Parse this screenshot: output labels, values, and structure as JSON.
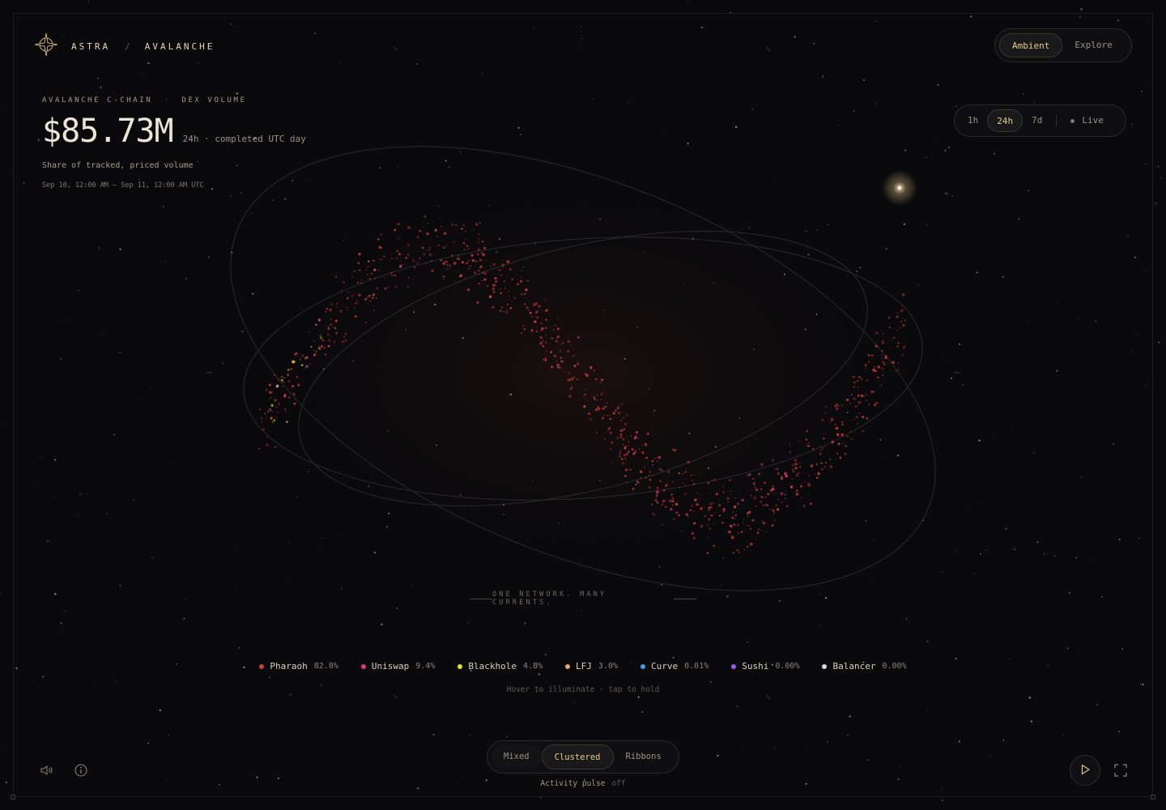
{
  "header": {
    "brand": "ASTRA",
    "separator": "/",
    "network": "AVALANCHE",
    "modes": [
      {
        "label": "Ambient",
        "active": true
      },
      {
        "label": "Explore",
        "active": false
      }
    ]
  },
  "timeframes": [
    {
      "label": "1h",
      "active": false
    },
    {
      "label": "24h",
      "active": true
    },
    {
      "label": "7d",
      "active": false
    }
  ],
  "live_label": "Live",
  "summary": {
    "chain": "AVALANCHE C-CHAIN",
    "metric": "DEX VOLUME",
    "value": "$85.73M",
    "period": "24h · completed UTC day",
    "share_label": "Share of tracked, priced volume",
    "range": "Sep 10, 12:00 AM – Sep 11, 12:00 AM UTC"
  },
  "tagline": "ONE NETWORK. MANY CURRENTS.",
  "legend": [
    {
      "name": "Pharaoh",
      "pct": "82.8%",
      "share": 0.828,
      "color": "#d23a32"
    },
    {
      "name": "Uniswap",
      "pct": "9.4%",
      "share": 0.094,
      "color": "#e0397a"
    },
    {
      "name": "Blackhole",
      "pct": "4.8%",
      "share": 0.048,
      "color": "#e5e51f"
    },
    {
      "name": "LFJ",
      "pct": "3.0%",
      "share": 0.03,
      "color": "#e8a77a"
    },
    {
      "name": "Curve",
      "pct": "0.01%",
      "share": 0.0001,
      "color": "#3f9cf0"
    },
    {
      "name": "Sushi",
      "pct": "0.00%",
      "share": 0.0,
      "color": "#9a5cf0"
    },
    {
      "name": "Balancer",
      "pct": "0.00%",
      "share": 0.0,
      "color": "#d8d8d8"
    }
  ],
  "hint": "Hover to illuminate · tap to hold",
  "views": [
    {
      "label": "Mixed",
      "active": false
    },
    {
      "label": "Clustered",
      "active": true
    },
    {
      "label": "Ribbons",
      "active": false
    }
  ],
  "activity_pulse": {
    "label": "Activity pulse",
    "state": "off"
  },
  "icons": {
    "logo": "compass-star-icon",
    "sound": "speaker-icon",
    "info": "info-icon",
    "play": "play-icon",
    "fullscreen": "fullscreen-icon"
  },
  "colors": {
    "accent": "#e6c98e",
    "background": "#0a0a0c"
  }
}
